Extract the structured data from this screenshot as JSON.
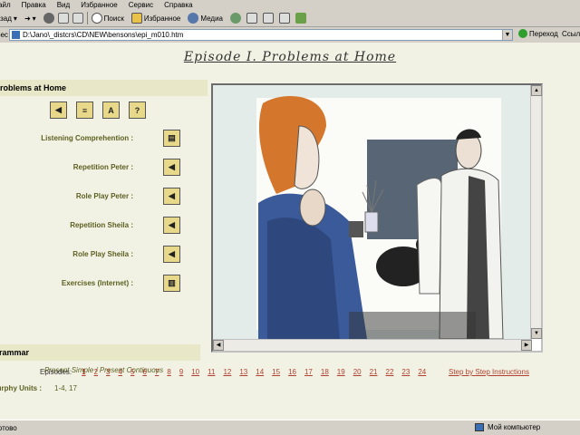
{
  "menu": {
    "items": [
      "Файл",
      "Правка",
      "Вид",
      "Избранное",
      "Сервис",
      "Справка"
    ]
  },
  "toolbar": {
    "back_label": "Назад",
    "search_label": "Поиск",
    "favorites_label": "Избранное",
    "media_label": "Медиа"
  },
  "address": {
    "label": "Адрес",
    "value": "D:\\Jano\\_distcrs\\CD\\NEW\\bensons\\epi_m010.htm",
    "go_label": "Переход",
    "links_label": "Ссылки"
  },
  "page": {
    "episode_title": "Episode I. Problems at Home",
    "section_title": "Problems at Home",
    "activities": [
      {
        "label": "Listening Comprehention :",
        "icon": "listen-icon"
      },
      {
        "label": "Repetition Peter :",
        "icon": "speaker-icon"
      },
      {
        "label": "Role Play Peter :",
        "icon": "speaker-icon"
      },
      {
        "label": "Repetition Sheila :",
        "icon": "speaker-icon"
      },
      {
        "label": "Role Play Sheila :",
        "icon": "speaker-icon"
      },
      {
        "label": "Exercises (Internet) :",
        "icon": "exercise-icon"
      }
    ],
    "grammar_title": "Grammar",
    "grammar_topic": "Present Simple / Present Continuous",
    "murphy_label": "Murphy Units :",
    "murphy_value": "1-4, 17",
    "episodes_label": "Episodes:",
    "episodes": [
      "1",
      "2",
      "3",
      "4",
      "5",
      "6",
      "7",
      "8",
      "9",
      "10",
      "11",
      "12",
      "13",
      "14",
      "15",
      "16",
      "17",
      "18",
      "19",
      "20",
      "21",
      "22",
      "23",
      "24"
    ],
    "step_label": "Step by Step Instructions"
  },
  "status": {
    "left": "Готово",
    "right": "Мой компьютер"
  },
  "colors": {
    "page_bg": "#f2f2e4",
    "section_bg": "#e8e8c8",
    "label_text": "#5a6020",
    "link": "#b04030",
    "button_fill": "#e8d88a"
  }
}
